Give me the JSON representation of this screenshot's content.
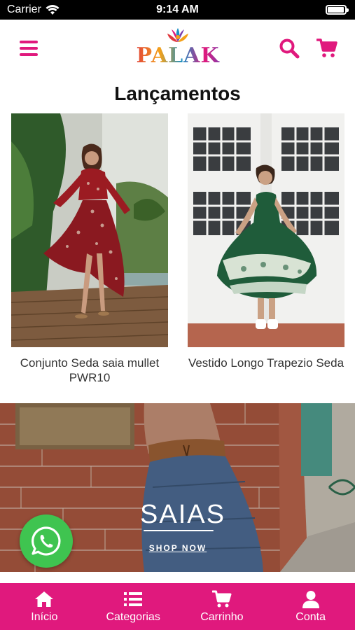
{
  "status_bar": {
    "carrier": "Carrier",
    "time": "9:14 AM",
    "battery_level": 0.95
  },
  "header": {
    "logo_text": "PALAK",
    "menu_icon": "hamburger-icon",
    "search_icon": "search-icon",
    "cart_icon": "cart-icon"
  },
  "section": {
    "title": "Lançamentos"
  },
  "products": [
    {
      "name": "Conjunto Seda saia mullet PWR10"
    },
    {
      "name": "Vestido Longo Trapezio Seda"
    }
  ],
  "banner": {
    "title": "SAIAS",
    "cta": "SHOP NOW"
  },
  "tabs": [
    {
      "label": "Início",
      "icon": "home-icon"
    },
    {
      "label": "Categorias",
      "icon": "list-icon"
    },
    {
      "label": "Carrinho",
      "icon": "cart-icon"
    },
    {
      "label": "Conta",
      "icon": "user-icon"
    }
  ],
  "colors": {
    "brand": "#e0197d",
    "whatsapp": "#3fc450"
  }
}
